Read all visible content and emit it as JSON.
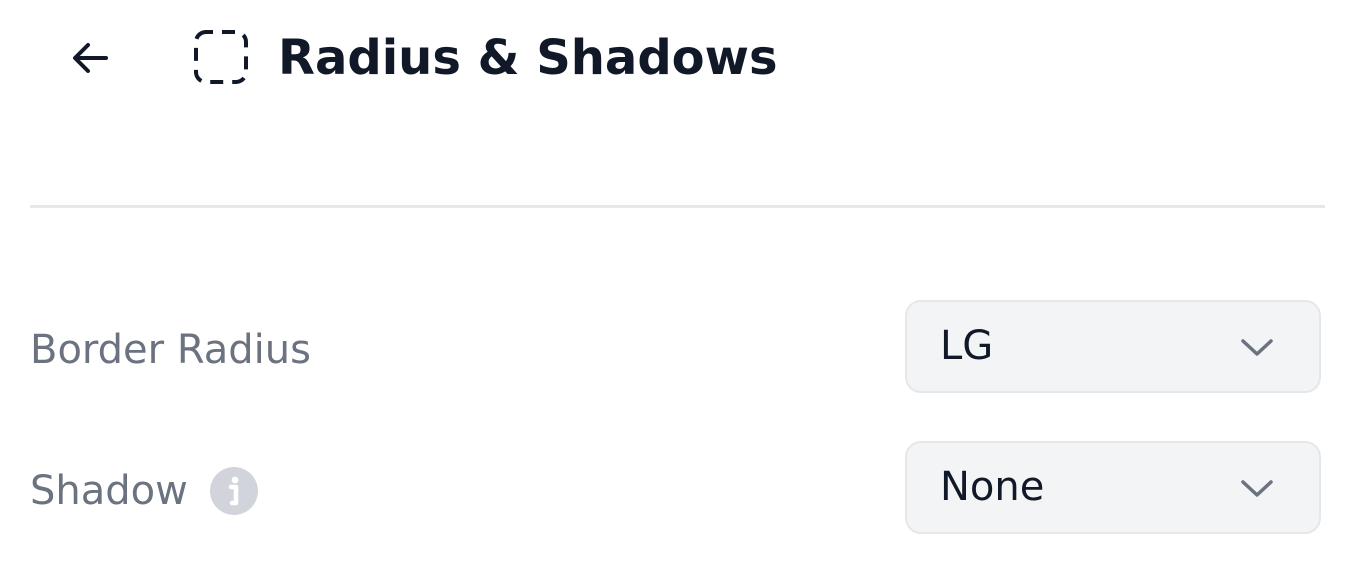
{
  "header": {
    "back_icon": "arrow-left-icon",
    "section_icon": "dashed-square-icon",
    "title": "Radius & Shadows"
  },
  "settings": {
    "border_radius": {
      "label": "Border Radius",
      "value": "LG",
      "icon": "chevron-down-icon"
    },
    "shadow": {
      "label": "Shadow",
      "info_icon": "info-icon",
      "value": "None",
      "icon": "chevron-down-icon"
    }
  },
  "colors": {
    "title": "#111827",
    "label": "#6b7280",
    "select_bg": "#f3f4f6",
    "select_border": "#e5e7eb",
    "info_icon": "#d1d5db"
  }
}
